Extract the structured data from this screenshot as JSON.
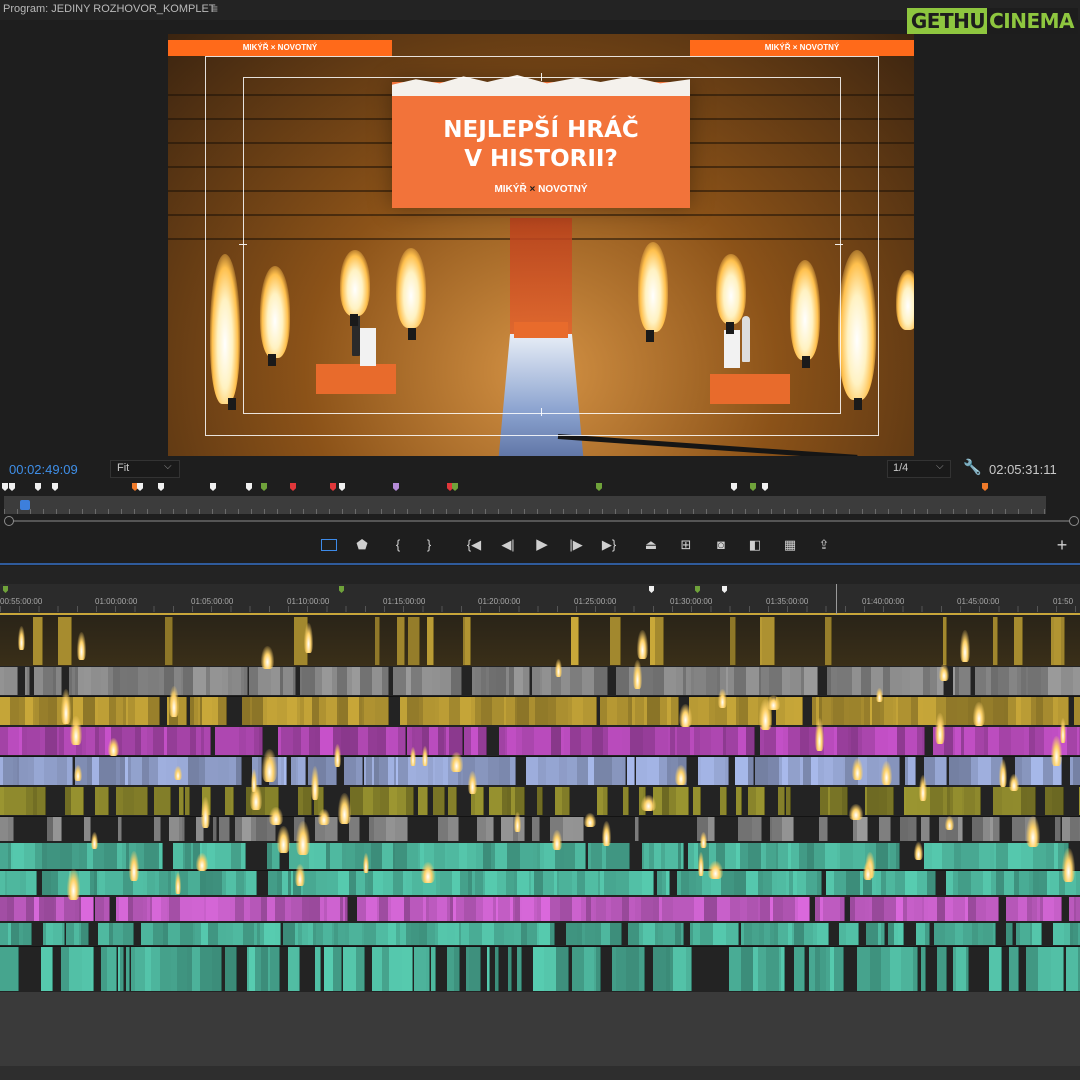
{
  "program_monitor": {
    "title": "Program: JEDINY ROZHOVOR_KOMPLET",
    "menu_icon": "hamburger-icon"
  },
  "brand_logo": {
    "part1": "GETHU",
    "part2": "CINEMA",
    "colors": {
      "green": "#8ec63f",
      "dark": "#1d1d1d"
    }
  },
  "video": {
    "screen_headline_line1": "NEJLEPŠÍ HRÁČ",
    "screen_headline_line2": "V HISTORII?",
    "screen_brand_left": "MIKÝŘ",
    "screen_brand_cross": "×",
    "screen_brand_right": "NOVOTNÝ",
    "led_strip_text": "MIKÝŘ × NOVOTNÝ",
    "colors": {
      "screen": "#f2733a",
      "led": "#ff6a1a"
    }
  },
  "controls": {
    "timecode_current": "00:02:49:09",
    "zoom_level": "Fit",
    "resolution": "1/4",
    "timecode_duration": "02:05:31:11",
    "accent_color": "#3d8ae8"
  },
  "marker_colors": {
    "white": "#f0f0f0",
    "orange": "#ef7a2a",
    "green": "#6fa23a",
    "red": "#e0373a",
    "purple": "#b58bd8"
  },
  "transport_icons": [
    "safe-margins-icon",
    "add-marker-icon",
    "mark-in-icon",
    "mark-out-icon",
    "go-to-in-icon",
    "step-back-icon",
    "play-icon",
    "step-forward-icon",
    "go-to-out-icon",
    "lift-icon",
    "extract-icon",
    "export-frame-icon",
    "comparison-view-icon",
    "toggle-proxies-icon",
    "export-icon",
    "add-button-icon"
  ],
  "timeline": {
    "ruler_labels": [
      "00:55:00:00",
      "01:00:00:00",
      "01:05:00:00",
      "01:10:00:00",
      "01:15:00:00",
      "01:20:00:00",
      "01:25:00:00",
      "01:30:00:00",
      "01:35:00:00",
      "01:40:00:00",
      "01:45:00:00",
      "01:50"
    ],
    "track_colors": {
      "gold": "#b89a34",
      "gray": "#8d8d8d",
      "magenta": "#b54ab8",
      "lavender": "#9aaad8",
      "olive": "#8f8a2d",
      "teal": "#4fb9a0",
      "pink": "#c65fc8"
    }
  }
}
